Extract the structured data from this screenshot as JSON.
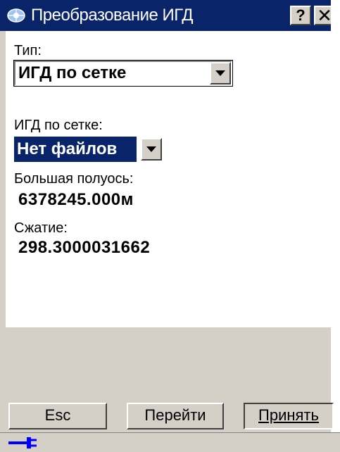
{
  "window": {
    "title": "Преобразование ИГД",
    "help_label": "?",
    "close_label": "✕"
  },
  "form": {
    "type_label": "Тип:",
    "type_value": "ИГД по сетке",
    "grid_label": "ИГД по сетке:",
    "grid_value": "Нет файлов",
    "semi_major_label": "Большая полуось:",
    "semi_major_value": "6378245.000м",
    "flattening_label": "Сжатие:",
    "flattening_value": "298.3000031662"
  },
  "buttons": {
    "esc": "Esc",
    "go": "Перейти",
    "accept": "Принять"
  },
  "status": {
    "connection_icon": "plug-icon"
  },
  "colors": {
    "titlebar": "#0a246a",
    "panel": "#d4d0c8",
    "selection": "#0a246a",
    "plug": "#0000ff"
  }
}
